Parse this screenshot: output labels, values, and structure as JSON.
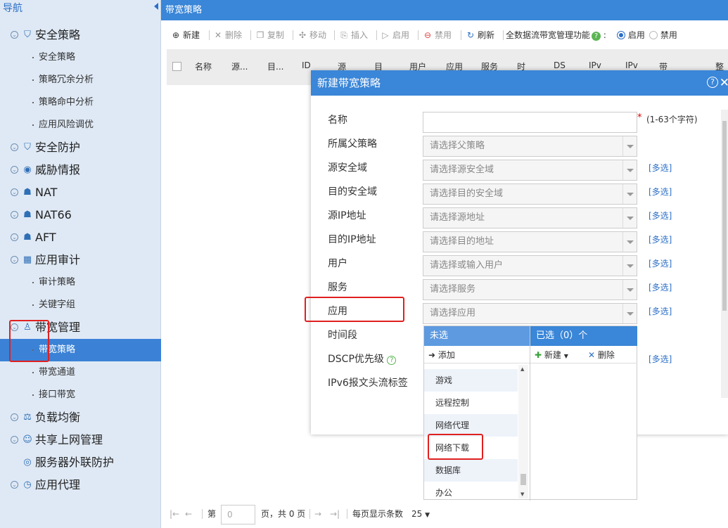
{
  "sidebar": {
    "header": "导航",
    "items": [
      {
        "label": "安全策略",
        "type": "top",
        "icon": "shield-icon"
      },
      {
        "label": "安全策略",
        "type": "sub"
      },
      {
        "label": "策略冗余分析",
        "type": "sub"
      },
      {
        "label": "策略命中分析",
        "type": "sub"
      },
      {
        "label": "应用风险调优",
        "type": "sub"
      },
      {
        "label": "安全防护",
        "type": "top",
        "icon": "shield-icon"
      },
      {
        "label": "威胁情报",
        "type": "top",
        "icon": "eye-icon"
      },
      {
        "label": "NAT",
        "type": "top",
        "icon": "network-icon"
      },
      {
        "label": "NAT66",
        "type": "top",
        "icon": "network-icon"
      },
      {
        "label": "AFT",
        "type": "top",
        "icon": "network-icon"
      },
      {
        "label": "应用审计",
        "type": "top",
        "icon": "grid-icon"
      },
      {
        "label": "审计策略",
        "type": "sub"
      },
      {
        "label": "关键字组",
        "type": "sub"
      },
      {
        "label": "带宽管理",
        "type": "top",
        "icon": "hierarchy-icon"
      },
      {
        "label": "带宽策略",
        "type": "sub",
        "active": true
      },
      {
        "label": "带宽通道",
        "type": "sub"
      },
      {
        "label": "接口带宽",
        "type": "sub"
      },
      {
        "label": "负载均衡",
        "type": "top",
        "icon": "balance-icon"
      },
      {
        "label": "共享上网管理",
        "type": "top",
        "icon": "users-icon"
      },
      {
        "label": "服务器外联防护",
        "type": "top",
        "icon": "server-shield-icon"
      },
      {
        "label": "应用代理",
        "type": "top",
        "icon": "compass-icon"
      }
    ]
  },
  "page": {
    "title": "带宽策略"
  },
  "toolbar": {
    "new": "新建",
    "delete": "删除",
    "copy": "复制",
    "move": "移动",
    "insert": "插入",
    "enable": "启用",
    "disable": "禁用",
    "refresh": "刷新",
    "global_label": "全数据流带宽管理功能",
    "global_enable": "启用",
    "global_disable": "禁用",
    "global_selected": "启用"
  },
  "grid": {
    "columns": [
      "名称",
      "源...",
      "目...",
      "ID",
      "源",
      "目",
      "用户",
      "应用",
      "服务",
      "时",
      "DS",
      "IPv",
      "IPv",
      "带",
      "整"
    ]
  },
  "pager": {
    "page_label": "第",
    "page_value": "0",
    "page_total": "页，共 0 页",
    "per_page_label": "每页显示条数",
    "per_page_value": "25"
  },
  "dialog": {
    "title": "新建带宽策略",
    "required_hint": "(1-63个字符)",
    "multi_label": "[多选]",
    "fields": {
      "name": {
        "label": "名称",
        "value": ""
      },
      "parent": {
        "label": "所属父策略",
        "placeholder": "请选择父策略"
      },
      "src_zone": {
        "label": "源安全域",
        "placeholder": "请选择源安全域"
      },
      "dst_zone": {
        "label": "目的安全域",
        "placeholder": "请选择目的安全域"
      },
      "src_ip": {
        "label": "源IP地址",
        "placeholder": "请选择源地址"
      },
      "dst_ip": {
        "label": "目的IP地址",
        "placeholder": "请选择目的地址"
      },
      "user": {
        "label": "用户",
        "placeholder": "请选择或输入用户"
      },
      "service": {
        "label": "服务",
        "placeholder": "请选择服务"
      },
      "app": {
        "label": "应用",
        "placeholder": "请选择应用"
      },
      "time": {
        "label": "时间段"
      },
      "dscp": {
        "label": "DSCP优先级"
      },
      "ipv6": {
        "label": "IPv6报文头流标签"
      }
    },
    "picker": {
      "unselected_label": "未选",
      "selected_label": "已选（0）个",
      "add": "添加",
      "new": "新建",
      "delete": "删除",
      "options": [
        "游戏",
        "远程控制",
        "网络代理",
        "网络下载",
        "数据库",
        "办公"
      ]
    }
  }
}
